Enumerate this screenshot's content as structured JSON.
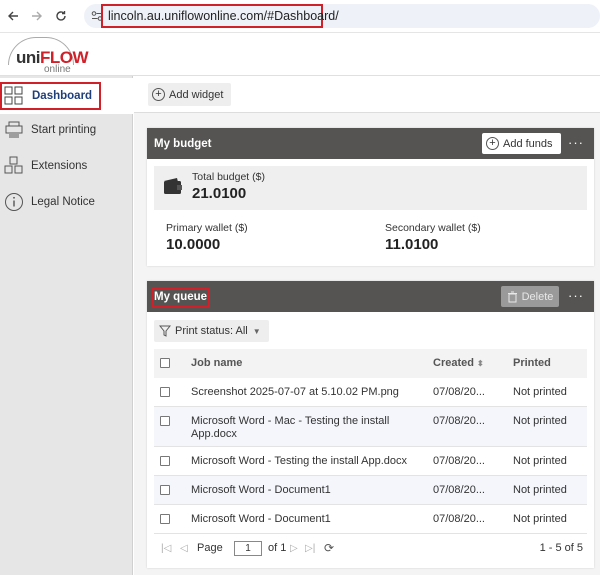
{
  "browser": {
    "url": "lincoln.au.uniflowonline.com/#Dashboard/",
    "back_icon": "arrow-left-icon",
    "forward_icon": "arrow-right-icon",
    "reload_icon": "reload-icon"
  },
  "logo": {
    "uni": "uni",
    "flow": "FLOW",
    "online": "online"
  },
  "sidebar": {
    "items": [
      {
        "label": "Dashboard",
        "icon": "dashboard-grid-icon",
        "active": true
      },
      {
        "label": "Start printing",
        "icon": "printer-icon"
      },
      {
        "label": "Extensions",
        "icon": "cubes-icon"
      },
      {
        "label": "Legal Notice",
        "icon": "info-icon"
      }
    ]
  },
  "toolbar": {
    "add_widget": "Add widget"
  },
  "budget": {
    "title": "My budget",
    "add_funds": "Add funds",
    "more": "···",
    "total_label": "Total budget ($)",
    "total_value": "21.0100",
    "primary_label": "Primary wallet ($)",
    "primary_value": "10.0000",
    "secondary_label": "Secondary wallet ($)",
    "secondary_value": "11.0100"
  },
  "queue": {
    "title": "My queue",
    "delete": "Delete",
    "more": "···",
    "filter": "Print status: All",
    "columns": {
      "job": "Job name",
      "created": "Created",
      "printed": "Printed"
    },
    "rows": [
      {
        "job": "Screenshot 2025-07-07 at 5.10.02 PM.png",
        "created": "07/08/20...",
        "printed": "Not printed"
      },
      {
        "job": "Microsoft Word - Mac - Testing the install App.docx",
        "created": "07/08/20...",
        "printed": "Not printed"
      },
      {
        "job": "Microsoft Word - Testing the install App.docx",
        "created": "07/08/20...",
        "printed": "Not printed"
      },
      {
        "job": "Microsoft Word - Document1",
        "created": "07/08/20...",
        "printed": "Not printed"
      },
      {
        "job": "Microsoft Word - Document1",
        "created": "07/08/20...",
        "printed": "Not printed"
      }
    ],
    "pager": {
      "page_label": "Page",
      "page_value": "1",
      "of_label": "of 1",
      "range": "1 - 5 of 5"
    }
  },
  "colors": {
    "highlight": "#d0202a",
    "card_header": "#555452",
    "active_nav": "#1f3f7a"
  }
}
